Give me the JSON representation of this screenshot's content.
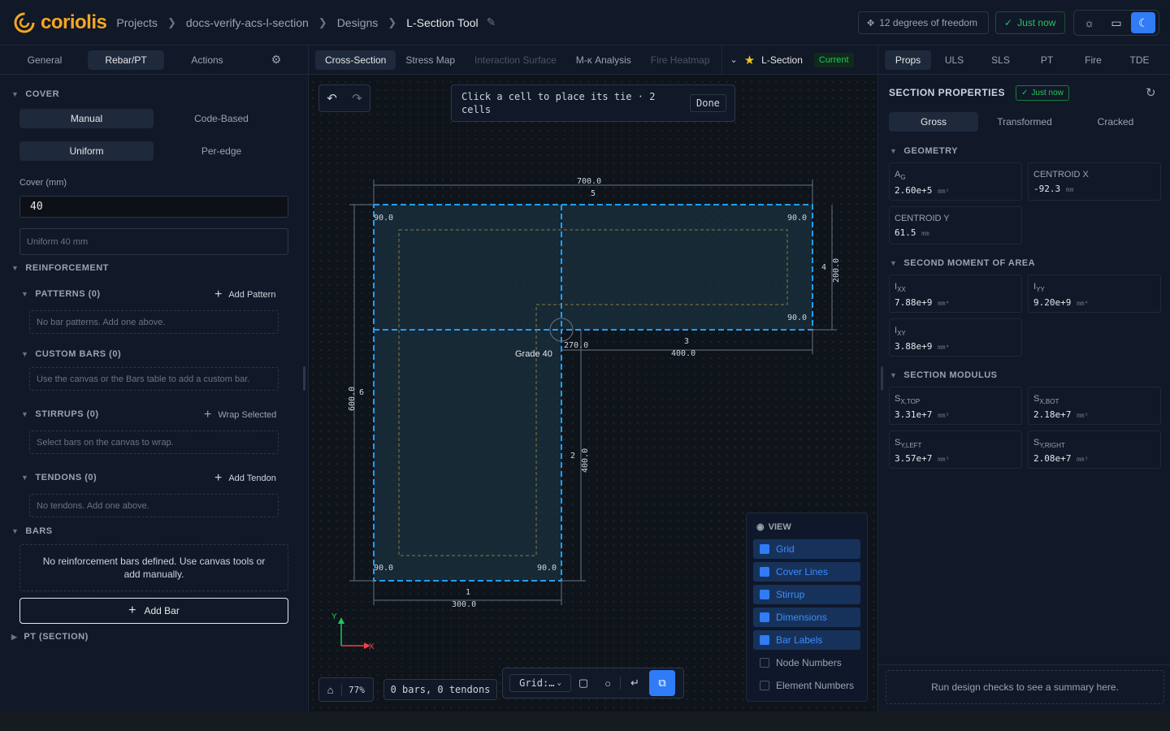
{
  "header": {
    "brand": "coriolis",
    "crumbs": [
      "Projects",
      "docs-verify-acs-l-section",
      "Designs",
      "L-Section Tool"
    ],
    "dof": "12 degrees of freedom",
    "saved": "Just now"
  },
  "left": {
    "tabs": [
      "General",
      "Rebar/PT",
      "Actions"
    ],
    "active_tab": "Rebar/PT",
    "cover": {
      "title": "COVER",
      "modes": [
        "Manual",
        "Code-Based"
      ],
      "edges": [
        "Uniform",
        "Per-edge"
      ],
      "cover_label": "Cover (mm)",
      "cover_value": "40",
      "summary": "Uniform 40 mm"
    },
    "reinforcement": "REINFORCEMENT",
    "patterns": {
      "title": "PATTERNS (0)",
      "add": "Add Pattern",
      "empty": "No bar patterns. Add one above."
    },
    "custom": {
      "title": "CUSTOM BARS (0)",
      "empty": "Use the canvas or the Bars table to add a custom bar."
    },
    "stirrups": {
      "title": "STIRRUPS (0)",
      "add": "Wrap Selected",
      "empty": "Select bars on the canvas to wrap."
    },
    "tendons": {
      "title": "TENDONS (0)",
      "add": "Add Tendon",
      "empty": "No tendons. Add one above."
    },
    "bars": {
      "title": "BARS",
      "empty": "No reinforcement bars defined. Use canvas tools or add manually.",
      "add": "Add Bar"
    },
    "pt": "PT (SECTION)"
  },
  "center": {
    "tabs": [
      "Cross-Section",
      "Stress Map",
      "Interaction Surface",
      "M-κ Analysis",
      "Fire Heatmap"
    ],
    "active_tab": "Cross-Section",
    "section_name": "L-Section",
    "section_status": "Current",
    "hint": "Click a cell to place its tie · 2 cells",
    "hint_done": "Done",
    "dims": {
      "top": "700.0",
      "top_edge": "5",
      "right": "200.0",
      "right_edge": "4",
      "step": "400.0",
      "step_edge": "3",
      "inner": "400.0",
      "inner_edge": "2",
      "bottom": "300.0",
      "bottom_edge": "1",
      "left": "600.0",
      "left_edge": "6",
      "corner_step": "270.0",
      "cover_tl": "90.0",
      "cover_tr": "90.0",
      "cover_r": "90.0",
      "cover_bl": "90.0",
      "cover_br": "90.0"
    },
    "material": "Grade 40",
    "axis_x": "X",
    "axis_y": "Y",
    "zoom": "77%",
    "counts": "0 bars, 0 tendons",
    "grid": "Grid:…",
    "view": {
      "title": "VIEW",
      "items": [
        {
          "label": "Grid",
          "on": true
        },
        {
          "label": "Cover Lines",
          "on": true
        },
        {
          "label": "Stirrup",
          "on": true
        },
        {
          "label": "Dimensions",
          "on": true
        },
        {
          "label": "Bar Labels",
          "on": true
        },
        {
          "label": "Node Numbers",
          "on": false
        },
        {
          "label": "Element Numbers",
          "on": false
        }
      ]
    }
  },
  "right": {
    "tabs": [
      "Props",
      "ULS",
      "SLS",
      "PT",
      "Fire",
      "TDE"
    ],
    "active_tab": "Props",
    "title": "SECTION PROPERTIES",
    "saved": "Just now",
    "modes": [
      "Gross",
      "Transformed",
      "Cracked"
    ],
    "geometry": {
      "title": "GEOMETRY",
      "ag_label": "A",
      "ag_sub": "G",
      "ag": "2.60e+5",
      "ag_unit": "mm²",
      "cx_label": "CENTROID X",
      "cx": "-92.3",
      "cx_unit": "mm",
      "cy_label": "CENTROID Y",
      "cy": "61.5",
      "cy_unit": "mm"
    },
    "moment": {
      "title": "SECOND MOMENT OF AREA",
      "ixx_sub": "XX",
      "ixx": "7.88e+9",
      "iyy_sub": "YY",
      "iyy": "9.20e+9",
      "ixy_sub": "XY",
      "ixy": "3.88e+9",
      "unit": "mm⁴"
    },
    "modulus": {
      "title": "SECTION MODULUS",
      "sxt_sub": "X,TOP",
      "sxt": "3.31e+7",
      "sxb_sub": "X,BOT",
      "sxb": "2.18e+7",
      "syl_sub": "Y,LEFT",
      "syl": "3.57e+7",
      "syr_sub": "Y,RIGHT",
      "syr": "2.08e+7",
      "unit": "mm³"
    },
    "summary": "Run design checks to see a summary here."
  },
  "colors": {
    "accent": "#2f7cf6",
    "brand": "#f5a623",
    "success": "#22c55e",
    "section_outline": "#1ea0ff"
  }
}
